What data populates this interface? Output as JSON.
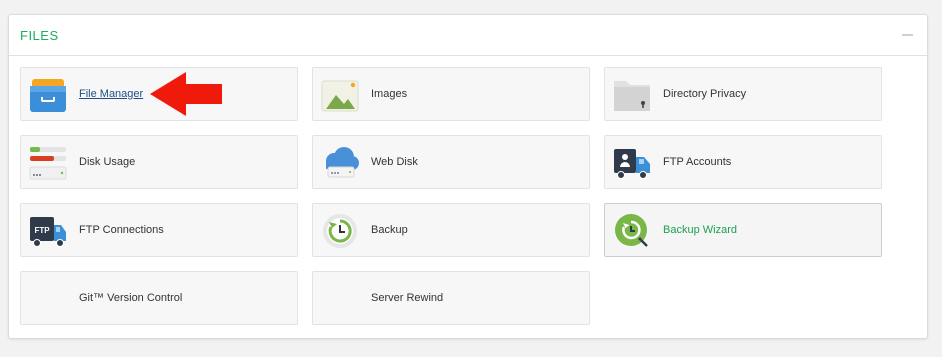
{
  "panel": {
    "title": "FILES",
    "collapse_icon": "minus-icon"
  },
  "tiles": [
    {
      "label": "File Manager",
      "icon": "file-manager-icon"
    },
    {
      "label": "Images",
      "icon": "images-icon"
    },
    {
      "label": "Directory Privacy",
      "icon": "directory-privacy-icon"
    },
    {
      "label": "Disk Usage",
      "icon": "disk-usage-icon"
    },
    {
      "label": "Web Disk",
      "icon": "web-disk-icon"
    },
    {
      "label": "FTP Accounts",
      "icon": "ftp-accounts-icon"
    },
    {
      "label": "FTP Connections",
      "icon": "ftp-connections-icon"
    },
    {
      "label": "Backup",
      "icon": "backup-icon"
    },
    {
      "label": "Backup Wizard",
      "icon": "backup-wizard-icon"
    },
    {
      "label": "Git™ Version Control",
      "icon": "git-icon"
    },
    {
      "label": "Server Rewind",
      "icon": "server-rewind-icon"
    }
  ],
  "annotation": {
    "icon": "red-arrow-pointer-icon",
    "color": "#f01a0c"
  },
  "colors": {
    "accent": "#19b05a",
    "link": "#1f4f86"
  }
}
